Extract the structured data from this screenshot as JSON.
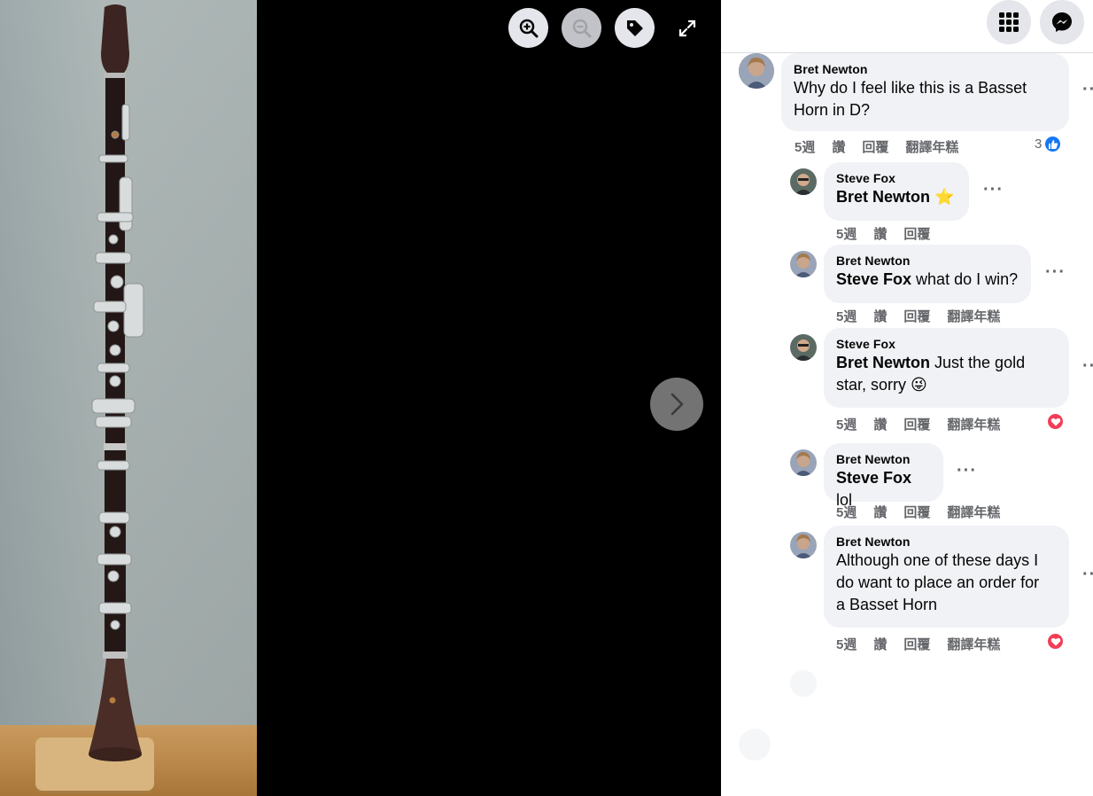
{
  "viewer": {
    "zoom_in": "zoom-in",
    "zoom_out": "zoom-out",
    "tag": "tag",
    "expand": "expand",
    "next": "next-photo"
  },
  "header": {
    "menu_icon": "grid-menu-icon",
    "messenger_icon": "messenger-icon"
  },
  "colors": {
    "like_blue": "#1877f2",
    "love_red": "#f33e58",
    "bubble_bg": "#f0f2f5",
    "meta_gray": "#65676b"
  },
  "comments": [
    {
      "author": "Bret Newton",
      "mention": "",
      "text_line1": "Why do I feel like this is a Basset",
      "text_line2": "Horn in D?",
      "time": "5週",
      "like": "讚",
      "reply": "回覆",
      "translate": "翻譯年糕",
      "reaction_count": "3",
      "reaction": "like"
    },
    {
      "author": "Steve Fox",
      "mention": "Bret Newton",
      "text": "",
      "emoji": "⭐",
      "time": "5週",
      "like": "讚",
      "reply": "回覆"
    },
    {
      "author": "Bret Newton",
      "mention": "Steve Fox",
      "text": " what do I win?",
      "time": "5週",
      "like": "讚",
      "reply": "回覆",
      "translate": "翻譯年糕"
    },
    {
      "author": "Steve Fox",
      "mention": "Bret Newton",
      "text_line1": " Just the gold",
      "text_line2": "star, sorry ",
      "emoji": "😜",
      "time": "5週",
      "like": "讚",
      "reply": "回覆",
      "translate": "翻譯年糕",
      "reaction": "love"
    },
    {
      "author": "Bret Newton",
      "mention": "Steve Fox",
      "text": " lol",
      "time": "5週",
      "like": "讚",
      "reply": "回覆",
      "translate": "翻譯年糕"
    },
    {
      "author": "Bret Newton",
      "mention": "",
      "text_line1": "Although one of these days I",
      "text_line2": "do want to place an order for",
      "text_line3": "a Basset Horn",
      "time": "5週",
      "like": "讚",
      "reply": "回覆",
      "translate": "翻譯年糕",
      "reaction": "love"
    }
  ],
  "more_label": "···"
}
